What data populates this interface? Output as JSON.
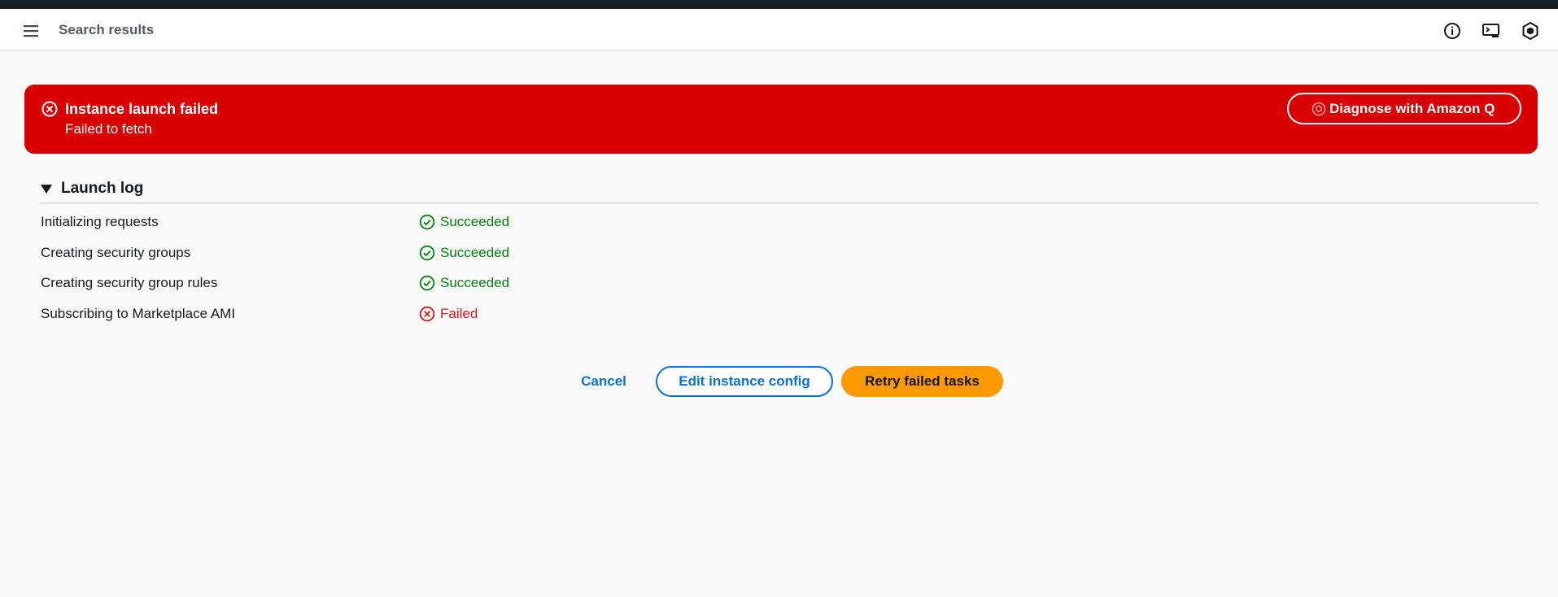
{
  "header": {
    "breadcrumb": "Search results",
    "icons": [
      "menu-icon",
      "info-icon",
      "cloudshell-icon",
      "amazon-q-icon"
    ]
  },
  "alert": {
    "title": "Instance launch failed",
    "message": "Failed to fetch",
    "action_label": "Diagnose with Amazon Q",
    "color": "#d80000"
  },
  "launch_log": {
    "title": "Launch log",
    "rows": [
      {
        "task": "Initializing requests",
        "status": "Succeeded",
        "state": "success"
      },
      {
        "task": "Creating security groups",
        "status": "Succeeded",
        "state": "success"
      },
      {
        "task": "Creating security group rules",
        "status": "Succeeded",
        "state": "success"
      },
      {
        "task": "Subscribing to Marketplace AMI",
        "status": "Failed",
        "state": "error"
      }
    ]
  },
  "actions": {
    "cancel_label": "Cancel",
    "edit_label": "Edit instance config",
    "retry_label": "Retry failed tasks"
  },
  "colors": {
    "success": "#037f0c",
    "error": "#d91515",
    "link": "#0972d3",
    "primary": "#ff9900"
  }
}
